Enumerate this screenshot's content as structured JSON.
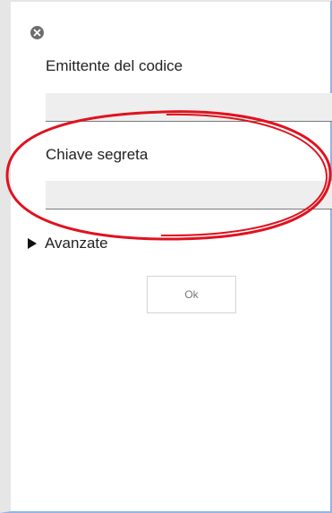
{
  "dialog": {
    "close_icon": "close-icon",
    "issuer_label": "Emittente del codice",
    "issuer_value": "",
    "secret_label": "Chiave segreta",
    "secret_value": "",
    "advanced_label": "Avanzate",
    "advanced_icon": "triangle-right-icon",
    "ok_label": "Ok"
  },
  "colors": {
    "annotation": "#e0121f",
    "field_bg": "#eeeeee",
    "accent_border": "#8fb6e6"
  }
}
